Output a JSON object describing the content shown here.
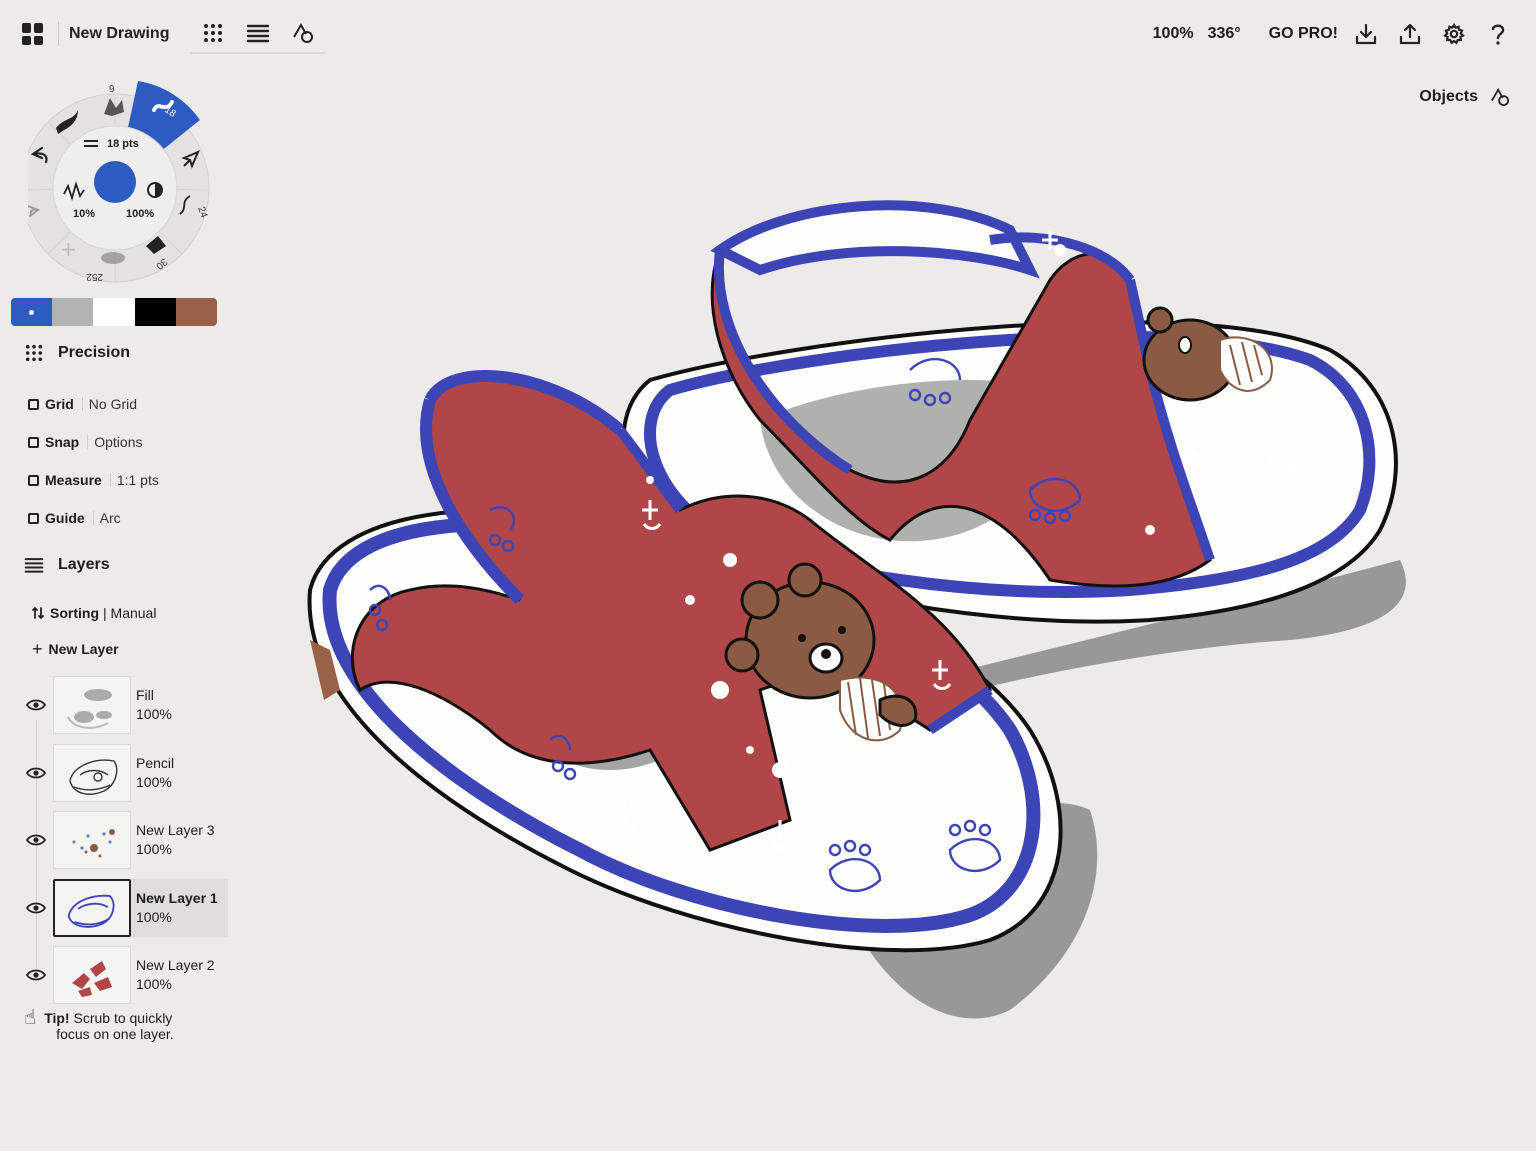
{
  "header": {
    "title": "New Drawing",
    "zoom": "100%",
    "rotation": "336°",
    "go_pro": "GO PRO!"
  },
  "objects_label": "Objects",
  "brush": {
    "size_label": "18 pts",
    "opacity_left": "10%",
    "opacity_right": "100%",
    "slot_top": "9",
    "slot_active": "18",
    "slot_right": "24",
    "slot_bottom_right": "30",
    "slot_bottom": "252",
    "color": "#2e5bc2"
  },
  "palette": [
    "#2e5bc2",
    "#b3b3b3",
    "#ffffff",
    "#000000",
    "#9a614a"
  ],
  "precision": {
    "title": "Precision",
    "rows": [
      {
        "name": "Grid",
        "value": "No Grid"
      },
      {
        "name": "Snap",
        "value": "Options"
      },
      {
        "name": "Measure",
        "value": "1:1 pts"
      },
      {
        "name": "Guide",
        "value": "Arc"
      }
    ]
  },
  "layers": {
    "title": "Layers",
    "sorting_label": "Sorting",
    "sorting_value": "| Manual",
    "new_layer": "New Layer",
    "items": [
      {
        "name": "Fill",
        "opacity": "100%"
      },
      {
        "name": "Pencil",
        "opacity": "100%"
      },
      {
        "name": "New Layer 3",
        "opacity": "100%"
      },
      {
        "name": "New Layer 1",
        "opacity": "100%"
      },
      {
        "name": "New Layer 2",
        "opacity": "100%"
      }
    ]
  },
  "tip": {
    "bold": "Tip!",
    "line1": " Scrub to quickly",
    "line2": "focus on one layer."
  },
  "colors": {
    "strap_red": "#b04648",
    "sole_blue": "#3c44b6",
    "bear_brown": "#8a5a42",
    "shadow": "#8a8a8a"
  }
}
